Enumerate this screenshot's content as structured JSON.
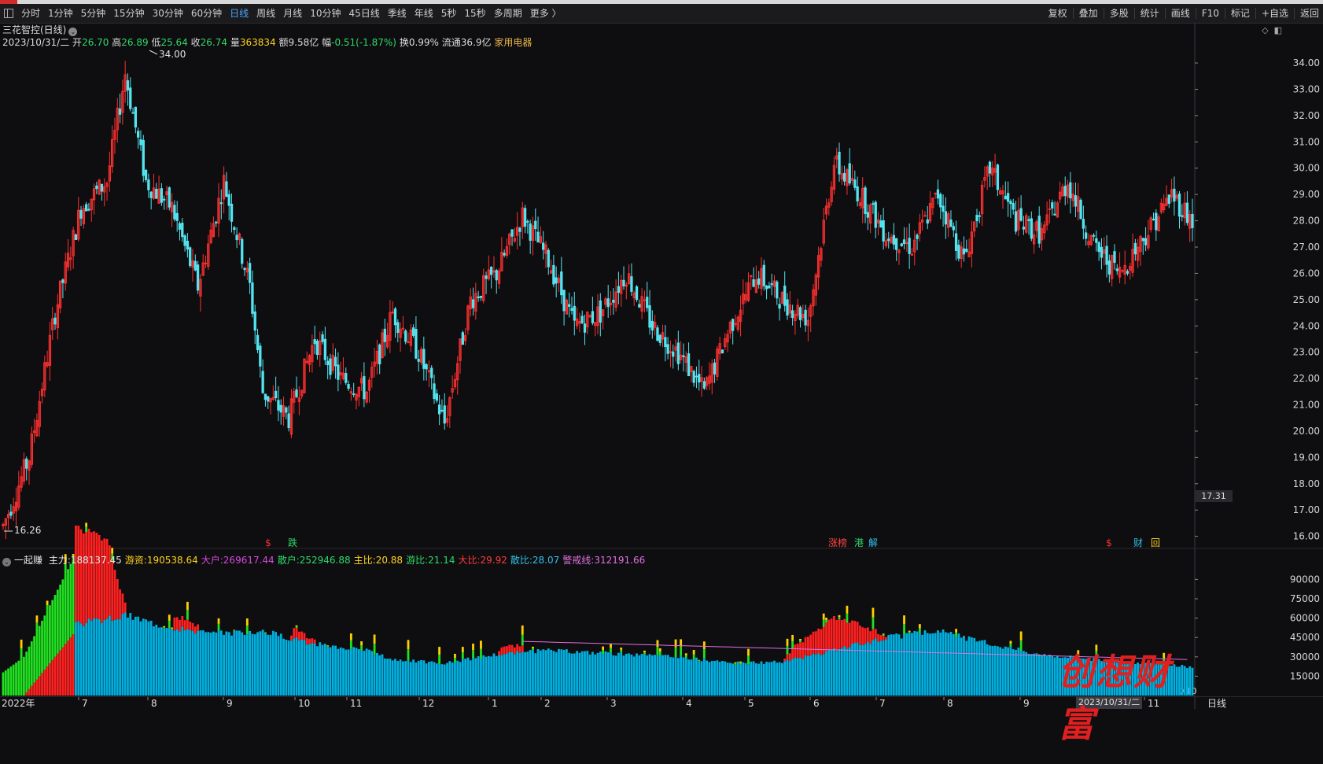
{
  "toolbar": {
    "periods": [
      {
        "label": "分时",
        "active": false
      },
      {
        "label": "1分钟",
        "active": false
      },
      {
        "label": "5分钟",
        "active": false
      },
      {
        "label": "15分钟",
        "active": false
      },
      {
        "label": "30分钟",
        "active": false
      },
      {
        "label": "60分钟",
        "active": false
      },
      {
        "label": "日线",
        "active": true
      },
      {
        "label": "周线",
        "active": false
      },
      {
        "label": "月线",
        "active": false
      },
      {
        "label": "10分钟",
        "active": false
      },
      {
        "label": "45日线",
        "active": false
      },
      {
        "label": "季线",
        "active": false
      },
      {
        "label": "年线",
        "active": false
      },
      {
        "label": "5秒",
        "active": false
      },
      {
        "label": "15秒",
        "active": false
      },
      {
        "label": "多周期",
        "active": false
      },
      {
        "label": "更多 〉",
        "active": false
      }
    ],
    "right_actions": [
      "复权",
      "叠加",
      "多股",
      "统计",
      "画线",
      "F10",
      "标记",
      "+自选",
      "返回"
    ]
  },
  "stock": {
    "title": "三花智控(日线)",
    "date": "2023/10/31/二",
    "open_label": "开",
    "open": "26.70",
    "high_label": "高",
    "high": "26.89",
    "low_label": "低",
    "low": "25.64",
    "close_label": "收",
    "close": "26.74",
    "volume_label": "量",
    "volume": "363834",
    "amount_label": "额",
    "amount": "9.58亿",
    "change_label": "幅",
    "change": "-0.51(-1.87%)",
    "turnover_label": "换",
    "turnover": "0.99%",
    "float_label": "流通",
    "float": "36.9亿",
    "sector": "家用电器"
  },
  "price_axis": {
    "ticks": [
      "34.00",
      "33.00",
      "32.00",
      "31.00",
      "30.00",
      "29.00",
      "28.00",
      "27.00",
      "26.00",
      "25.00",
      "24.00",
      "23.00",
      "22.00",
      "21.00",
      "20.00",
      "19.00",
      "18.00",
      "17.00",
      "16.00"
    ],
    "max_label": "34.00",
    "min_label": "16.26",
    "cursor_price": "17.31",
    "ymin": 15.6,
    "ymax": 34.6
  },
  "markers": [
    {
      "text": "$",
      "color": "#ff3030"
    },
    {
      "text": "跌",
      "color": "#2fd96a"
    },
    {
      "text": "涨榜",
      "color": "#ff4444"
    },
    {
      "text": "港",
      "color": "#2fd96a"
    },
    {
      "text": "解",
      "color": "#32c0e8"
    },
    {
      "text": "$",
      "color": "#ff3030"
    },
    {
      "text": "财",
      "color": "#32c0e8"
    },
    {
      "text": "回",
      "color": "#ffd21c"
    }
  ],
  "indicator": {
    "name": "一起赚",
    "fields": [
      {
        "label": "主力:",
        "value": "188137.45",
        "color": "#e6e6e6"
      },
      {
        "label": "游资:",
        "value": "190538.64",
        "color": "#ffd21c"
      },
      {
        "label": "大户:",
        "value": "269617.44",
        "color": "#d848e0"
      },
      {
        "label": "散户:",
        "value": "252946.88",
        "color": "#2fd96a"
      },
      {
        "label": "主比:",
        "value": "20.88",
        "color": "#ffd21c"
      },
      {
        "label": "游比:",
        "value": "21.14",
        "color": "#2fd96a"
      },
      {
        "label": "大比:",
        "value": "29.92",
        "color": "#ff3a3a"
      },
      {
        "label": "散比:",
        "value": "28.07",
        "color": "#32c0e8"
      },
      {
        "label": "警戒线:",
        "value": "312191.66",
        "color": "#e070e0"
      }
    ],
    "ticks": [
      "90000",
      "75000",
      "60000",
      "45000",
      "30000",
      "15000"
    ],
    "unit": "X10"
  },
  "dates": {
    "year": "2022年",
    "months": [
      "7",
      "8",
      "9",
      "10",
      "11",
      "12",
      "1",
      "2",
      "3",
      "4",
      "5",
      "6",
      "7",
      "8",
      "9",
      "11"
    ],
    "cursor_date": "2023/10/31/二",
    "period_label": "日线"
  },
  "watermark": "创想财富",
  "colors": {
    "up": "#ff3030",
    "down": "#54e4f0",
    "bg": "#0e0e10",
    "accent": "#4aa8ff"
  }
}
